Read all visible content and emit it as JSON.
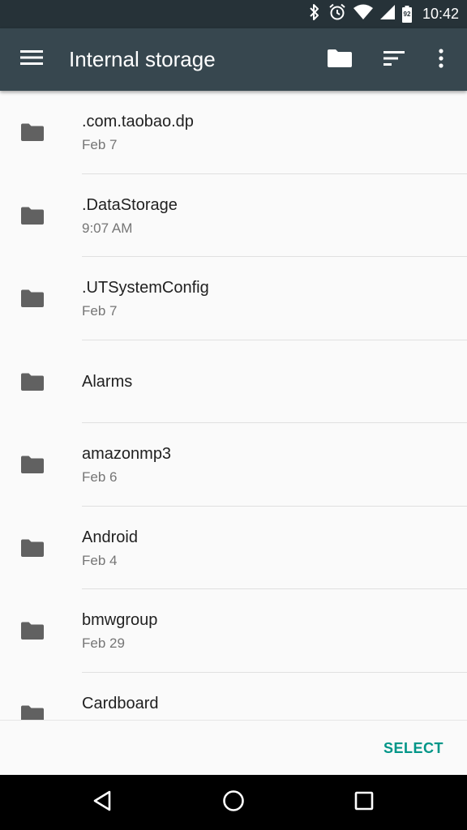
{
  "status_bar": {
    "time": "10:42",
    "battery_level": "92",
    "icons": [
      "bluetooth-icon",
      "alarm-icon",
      "wifi-icon",
      "cell-signal-icon",
      "battery-icon"
    ]
  },
  "toolbar": {
    "title": "Internal storage",
    "icons": [
      "menu-icon",
      "folder-icon",
      "sort-icon",
      "more-vert-icon"
    ]
  },
  "files": [
    {
      "name": ".com.taobao.dp",
      "date": "Feb 7"
    },
    {
      "name": ".DataStorage",
      "date": "9:07 AM"
    },
    {
      "name": ".UTSystemConfig",
      "date": "Feb 7"
    },
    {
      "name": "Alarms",
      "date": ""
    },
    {
      "name": "amazonmp3",
      "date": "Feb 6"
    },
    {
      "name": "Android",
      "date": "Feb 4"
    },
    {
      "name": "bmwgroup",
      "date": "Feb 29"
    },
    {
      "name": "Cardboard",
      "date": ""
    }
  ],
  "bottom_bar": {
    "select_label": "SELECT"
  },
  "nav_bar": {
    "icons": [
      "back-icon",
      "home-icon",
      "recents-icon"
    ]
  },
  "colors": {
    "status_bar": "#263238",
    "toolbar": "#37474f",
    "background": "#fafafa",
    "folder_icon": "#616161",
    "accent": "#009688"
  }
}
